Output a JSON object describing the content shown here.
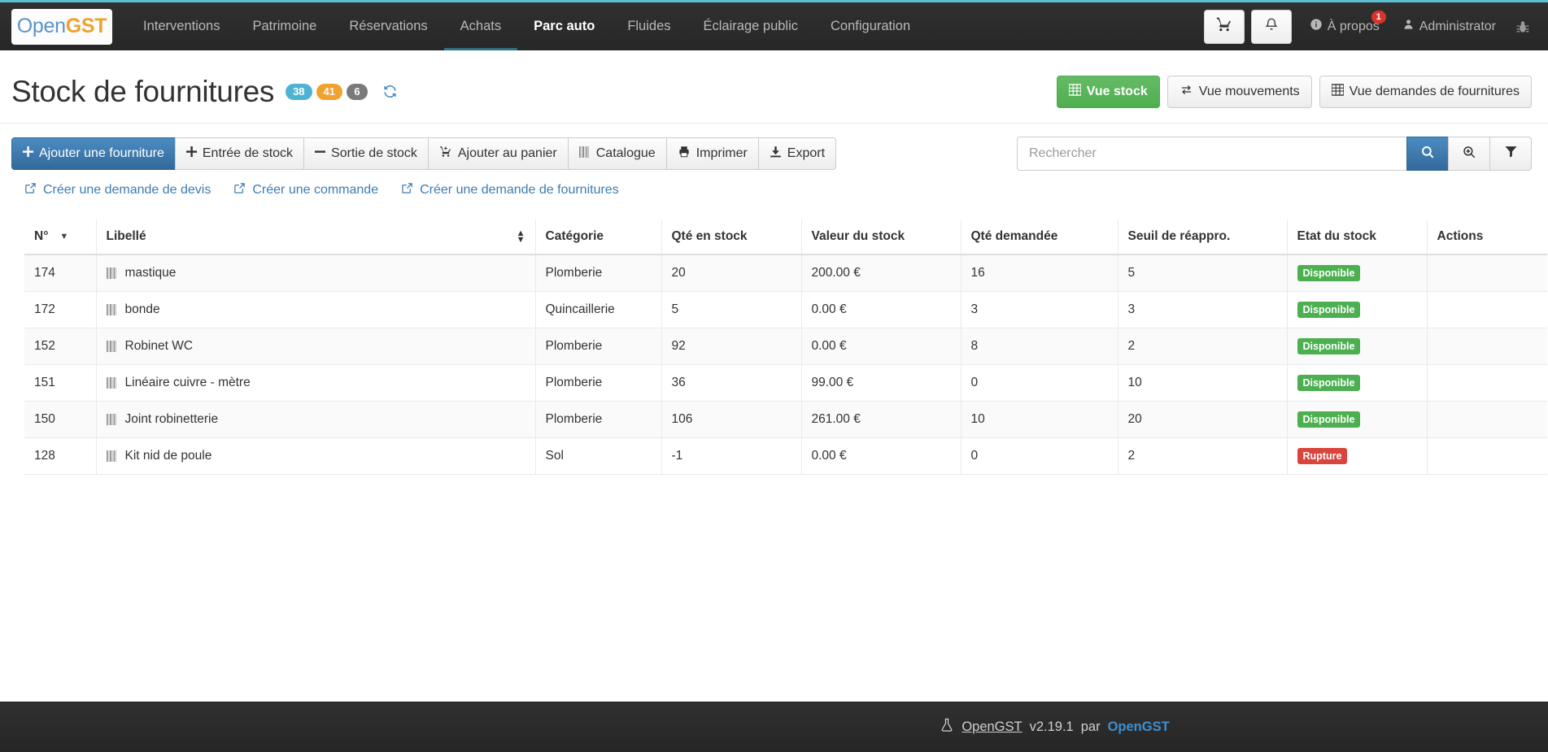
{
  "navbar": {
    "brand": {
      "first": "Open",
      "second": "GST"
    },
    "items": [
      {
        "label": "Interventions",
        "active": false
      },
      {
        "label": "Patrimoine",
        "active": false
      },
      {
        "label": "Réservations",
        "active": false
      },
      {
        "label": "Achats",
        "active": false,
        "underlined": true
      },
      {
        "label": "Parc auto",
        "active": true
      },
      {
        "label": "Fluides",
        "active": false
      },
      {
        "label": "Éclairage public",
        "active": false
      },
      {
        "label": "Configuration",
        "active": false
      }
    ],
    "cart_icon": "shopping-cart-icon",
    "bell_icon": "bell-icon",
    "bell_badge": "1",
    "about_label": "À propos",
    "user_label": "Administrator",
    "bug_icon": "bug-icon",
    "accent_color": "#5bc0d4"
  },
  "header": {
    "title": "Stock de fournitures",
    "badges": [
      {
        "value": "38",
        "color": "#4eb3d3"
      },
      {
        "value": "41",
        "color": "#f0a22e"
      },
      {
        "value": "6",
        "color": "#7a7a7a"
      }
    ],
    "refresh_icon": "refresh-icon",
    "views": [
      {
        "label": "Vue stock",
        "icon": "grid-icon",
        "active": true
      },
      {
        "label": "Vue mouvements",
        "icon": "exchange-icon",
        "active": false
      },
      {
        "label": "Vue demandes de fournitures",
        "icon": "table-icon",
        "active": false
      }
    ]
  },
  "toolbar": {
    "buttons": [
      {
        "label": "Ajouter une fourniture",
        "icon": "plus-icon",
        "primary": true
      },
      {
        "label": "Entrée de stock",
        "icon": "plus-icon",
        "primary": false
      },
      {
        "label": "Sortie de stock",
        "icon": "minus-icon",
        "primary": false
      },
      {
        "label": "Ajouter au panier",
        "icon": "cart-plus-icon",
        "primary": false
      },
      {
        "label": "Catalogue",
        "icon": "barcode-icon",
        "primary": false
      },
      {
        "label": "Imprimer",
        "icon": "print-icon",
        "primary": false
      },
      {
        "label": "Export",
        "icon": "download-icon",
        "primary": false
      }
    ],
    "search": {
      "value": "",
      "placeholder": "Rechercher"
    },
    "search_button_icon": "search-icon",
    "advanced_search_icon": "search-plus-icon",
    "filter_icon": "filter-icon"
  },
  "links": [
    {
      "label": "Créer une demande de devis",
      "icon": "external-link-icon"
    },
    {
      "label": "Créer une commande",
      "icon": "external-link-icon"
    },
    {
      "label": "Créer une demande de fournitures",
      "icon": "external-link-icon"
    }
  ],
  "table": {
    "columns": [
      {
        "label": "N°",
        "sort": "desc"
      },
      {
        "label": "Libellé",
        "sort": "both"
      },
      {
        "label": "Catégorie",
        "sort": "none"
      },
      {
        "label": "Qté en stock",
        "sort": "none"
      },
      {
        "label": "Valeur du stock",
        "sort": "none"
      },
      {
        "label": "Qté demandée",
        "sort": "none"
      },
      {
        "label": "Seuil de réappro.",
        "sort": "none"
      },
      {
        "label": "Etat du stock",
        "sort": "none"
      },
      {
        "label": "Actions",
        "sort": "none"
      }
    ],
    "rows": [
      {
        "num": "174",
        "label": "mastique",
        "categorie": "Plomberie",
        "qte_stock": "20",
        "valeur": "200.00 €",
        "qte_demandee": "16",
        "seuil": "5",
        "etat": "Disponible",
        "etat_color": "#4caf50",
        "actions": ""
      },
      {
        "num": "172",
        "label": "bonde",
        "categorie": "Quincaillerie",
        "qte_stock": "5",
        "valeur": "0.00 €",
        "qte_demandee": "3",
        "seuil": "3",
        "etat": "Disponible",
        "etat_color": "#4caf50",
        "actions": ""
      },
      {
        "num": "152",
        "label": "Robinet WC",
        "categorie": "Plomberie",
        "qte_stock": "92",
        "valeur": "0.00 €",
        "qte_demandee": "8",
        "seuil": "2",
        "etat": "Disponible",
        "etat_color": "#4caf50",
        "actions": ""
      },
      {
        "num": "151",
        "label": "Linéaire cuivre - mètre",
        "categorie": "Plomberie",
        "qte_stock": "36",
        "valeur": "99.00 €",
        "qte_demandee": "0",
        "seuil": "10",
        "etat": "Disponible",
        "etat_color": "#4caf50",
        "actions": ""
      },
      {
        "num": "150",
        "label": "Joint robinetterie",
        "categorie": "Plomberie",
        "qte_stock": "106",
        "valeur": "261.00 €",
        "qte_demandee": "10",
        "seuil": "20",
        "etat": "Disponible",
        "etat_color": "#4caf50",
        "actions": ""
      },
      {
        "num": "128",
        "label": "Kit nid de poule",
        "categorie": "Sol",
        "qte_stock": "-1",
        "valeur": "0.00 €",
        "qte_demandee": "0",
        "seuil": "2",
        "etat": "Rupture",
        "etat_color": "#d9453c",
        "actions": ""
      }
    ]
  },
  "footer": {
    "icon": "flask-icon",
    "app": "OpenGST",
    "version": "v2.19.1",
    "by": "par",
    "vendor": "OpenGST"
  }
}
